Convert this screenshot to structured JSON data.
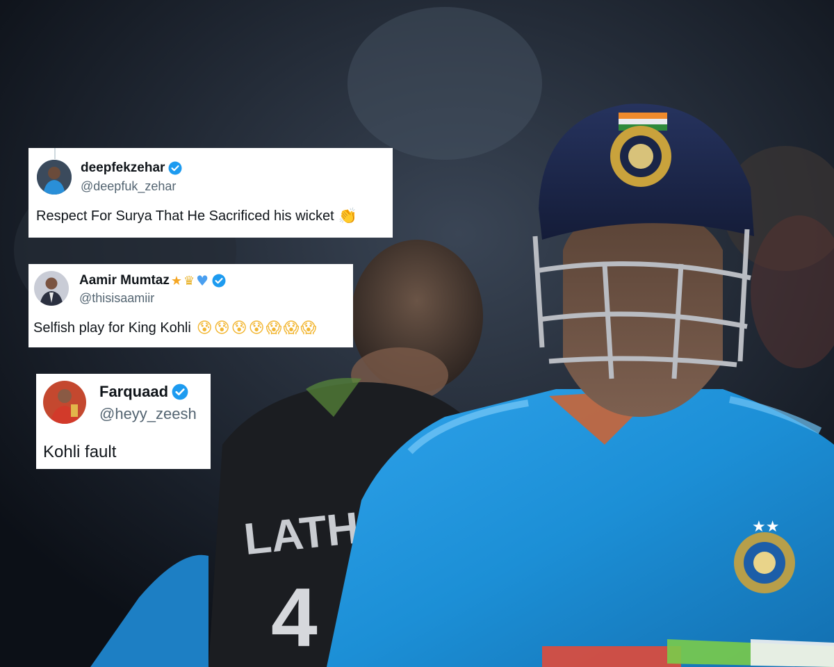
{
  "colors": {
    "jersey_blue": "#1c8fd6",
    "helmet_navy": "#1a2547",
    "verified_blue": "#1d9bf0",
    "handle_gray": "#536471",
    "opponent_black": "#1b1d21"
  },
  "scene": {
    "jersey_lettering": "LATH",
    "jersey_number": "4"
  },
  "tweets": [
    {
      "display_name": "deepfekzehar",
      "handle": "@deepfuk_zehar",
      "text": "Respect For Surya That He Sacrificed his wicket",
      "emojis": [
        "clapping-hands"
      ],
      "verified": true
    },
    {
      "display_name": "Aamir Mumtaz",
      "name_emojis": [
        "star",
        "crown",
        "blue-heart"
      ],
      "handle": "@thisisaamiir",
      "text": "Selfish play for King Kohli",
      "emojis": [
        "anxious-face",
        "anxious-face",
        "anxious-face",
        "anxious-face",
        "screaming-face",
        "screaming-face",
        "screaming-face"
      ],
      "verified": true
    },
    {
      "display_name": "Farquaad",
      "handle": "@heyy_zeesh",
      "text": "Kohli fault",
      "emojis": [],
      "verified": true
    }
  ]
}
